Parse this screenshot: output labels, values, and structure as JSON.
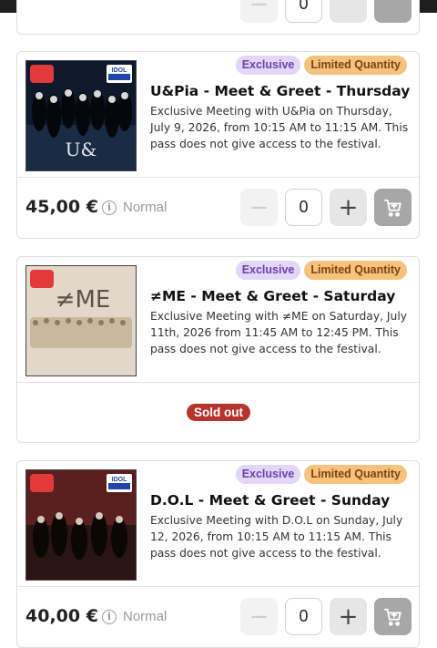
{
  "cards": [
    {
      "badges": {
        "exclusive": "Exclusive",
        "limited": "Limited Quantity"
      },
      "title": "U&Pia - Meet & Greet - Thursday",
      "description": "Exclusive Meeting with U&Pia on Thursday, July 9, 2026, from 10:15 AM to 11:15 AM. This pass does not give access to the festival.",
      "price": "45,00 €",
      "rate": "Normal",
      "quantity": "0",
      "thumb_text": "U&"
    },
    {
      "badges": {
        "exclusive": "Exclusive",
        "limited": "Limited Quantity"
      },
      "title": "≠ME - Meet & Greet - Saturday",
      "description": "Exclusive Meeting with ≠ME on Saturday, July 11th, 2026 from 11:45 AM to 12:45 PM. This pass does not give access to the festival.",
      "status": "Sold out",
      "thumb_text": "≠ME"
    },
    {
      "badges": {
        "exclusive": "Exclusive",
        "limited": "Limited Quantity"
      },
      "title": "D.O.L - Meet & Greet - Sunday",
      "description": "Exclusive Meeting with D.O.L on Sunday, July 12, 2026, from 10:15 AM to 11:15 AM. This pass does not give access to the festival.",
      "price": "40,00 €",
      "rate": "Normal",
      "quantity": "0"
    }
  ],
  "top_partial": {
    "quantity": "0"
  },
  "icons": {
    "minus": "minus-icon",
    "plus": "plus-icon",
    "cart": "add-to-cart-icon",
    "info": "info-icon"
  },
  "colors": {
    "exclusive_bg": "#e3d7f7",
    "limited_bg": "#f6c27e",
    "soldout": "#b5342e",
    "cart_btn": "#a7a7a7"
  }
}
